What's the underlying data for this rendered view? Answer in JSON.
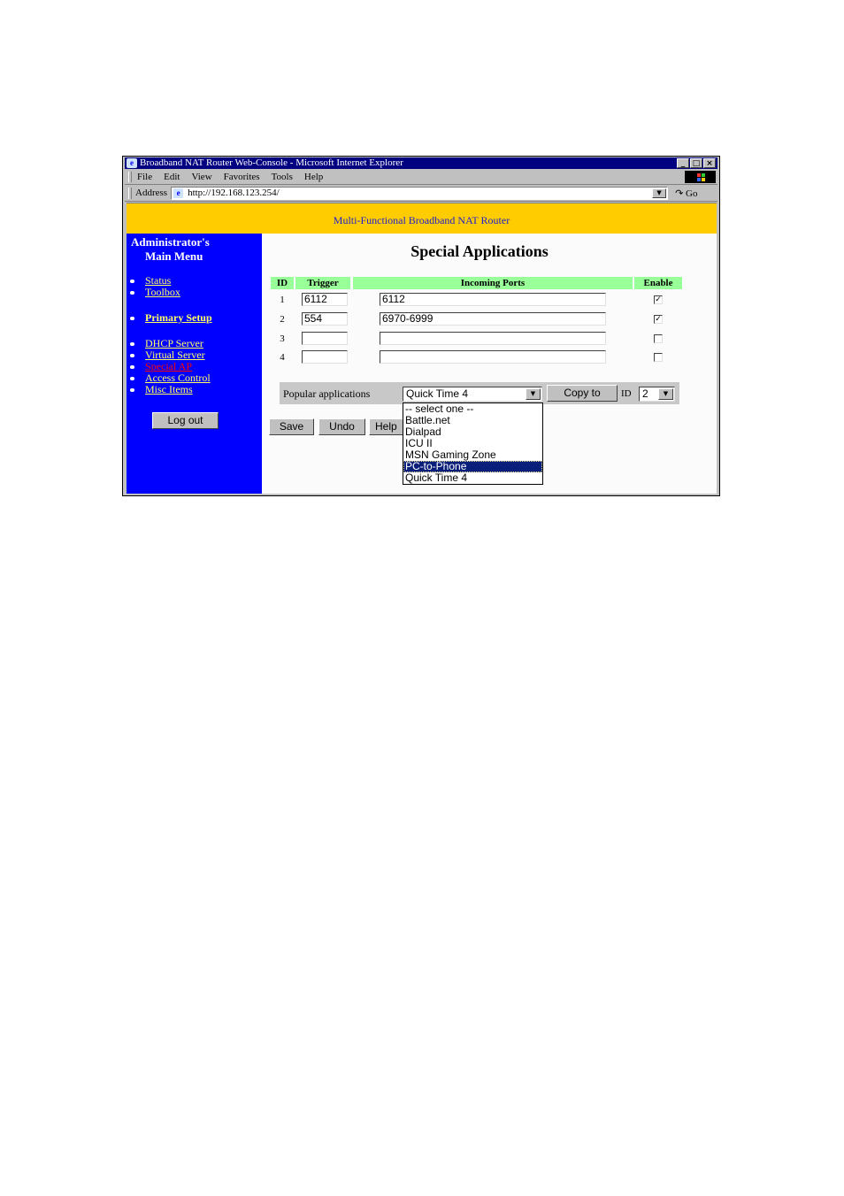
{
  "window": {
    "title": "Broadband NAT Router Web-Console - Microsoft Internet Explorer",
    "controls": [
      "minimize",
      "maximize",
      "close"
    ]
  },
  "menubar": {
    "items": [
      "File",
      "Edit",
      "View",
      "Favorites",
      "Tools",
      "Help"
    ]
  },
  "address_bar": {
    "label": "Address",
    "url": "http://192.168.123.254/",
    "go_label": "Go"
  },
  "banner": {
    "text": "Multi-Functional Broadband NAT Router"
  },
  "sidebar": {
    "heading_line1": "Administrator's",
    "heading_line2": "Main Menu",
    "items": [
      {
        "label": "Status"
      },
      {
        "label": "Toolbox"
      },
      {
        "label": "Primary Setup"
      },
      {
        "label": "DHCP Server"
      },
      {
        "label": "Virtual Server"
      },
      {
        "label": "Special AP"
      },
      {
        "label": "Access Control"
      },
      {
        "label": "Misc Items"
      }
    ],
    "logout_label": "Log out"
  },
  "main": {
    "title": "Special Applications",
    "table": {
      "headers": {
        "id": "ID",
        "trigger": "Trigger",
        "incoming": "Incoming Ports",
        "enable": "Enable"
      },
      "rows": [
        {
          "id": "1",
          "trigger": "6112",
          "incoming": "6112",
          "enabled": true
        },
        {
          "id": "2",
          "trigger": "554",
          "incoming": "6970-6999",
          "enabled": true
        },
        {
          "id": "3",
          "trigger": "",
          "incoming": "",
          "enabled": false
        },
        {
          "id": "4",
          "trigger": "",
          "incoming": "",
          "enabled": false
        }
      ]
    },
    "popular": {
      "label": "Popular applications",
      "selected": "Quick Time 4",
      "copy_label": "Copy to",
      "id_label": "ID",
      "id_selected": "2",
      "options": [
        "-- select one --",
        "Battle.net",
        "Dialpad",
        "ICU II",
        "MSN Gaming Zone",
        "PC-to-Phone",
        "Quick Time 4"
      ],
      "highlighted": "PC-to-Phone"
    },
    "buttons": {
      "save": "Save",
      "undo": "Undo",
      "help": "Help"
    }
  },
  "colors": {
    "banner": "#ffcc00",
    "sidebar": "#0000ff",
    "header_row": "#99ff99",
    "link": "#ffff66",
    "current_link": "#ff0000",
    "titlebar": "#000080"
  }
}
